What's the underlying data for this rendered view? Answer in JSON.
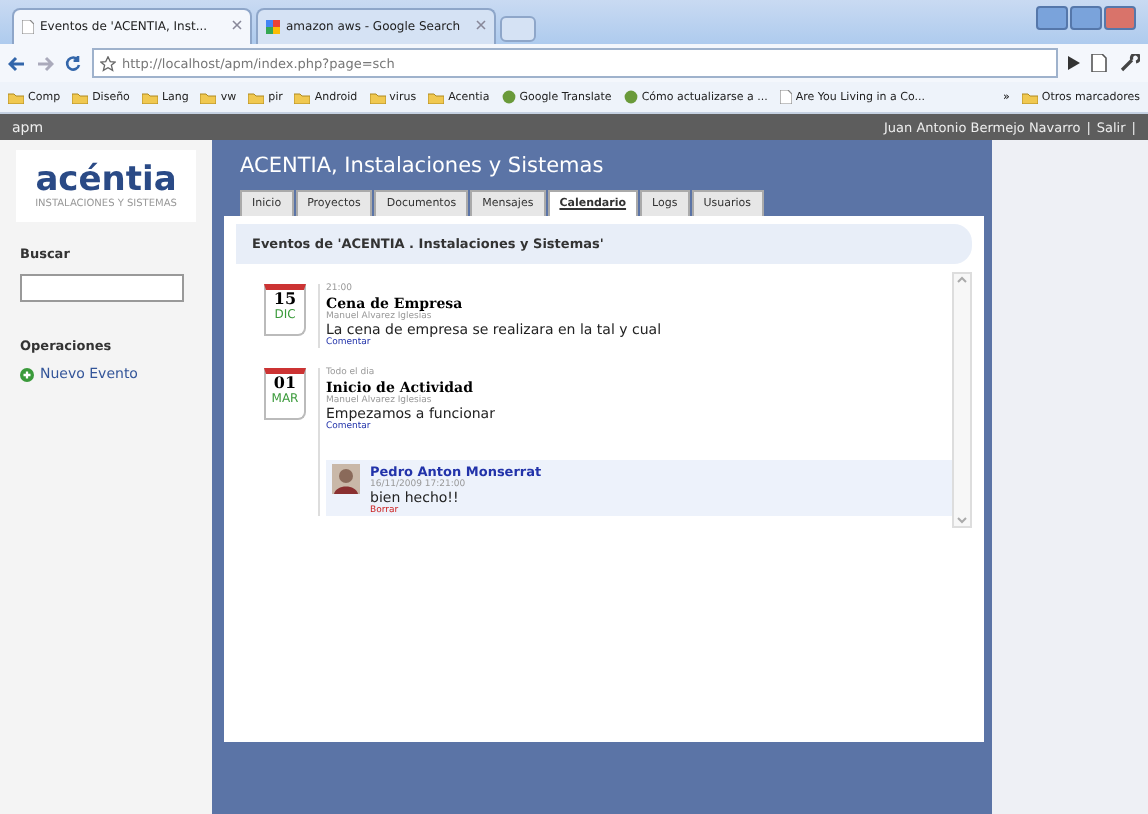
{
  "browser": {
    "tabs": [
      {
        "label": "Eventos de 'ACENTIA, Inst...",
        "selected": true
      },
      {
        "label": "amazon aws - Google Search",
        "selected": false
      }
    ],
    "url": "http://localhost/apm/index.php?page=sch",
    "bookmarks": [
      {
        "label": "Comp",
        "kind": "folder"
      },
      {
        "label": "Diseño",
        "kind": "folder"
      },
      {
        "label": "Lang",
        "kind": "folder"
      },
      {
        "label": "vw",
        "kind": "folder"
      },
      {
        "label": "pir",
        "kind": "folder"
      },
      {
        "label": "Android",
        "kind": "folder"
      },
      {
        "label": "virus",
        "kind": "folder"
      },
      {
        "label": "Acentia",
        "kind": "folder"
      },
      {
        "label": "Google Translate",
        "kind": "site"
      },
      {
        "label": "Cómo actualizarse a ...",
        "kind": "site"
      },
      {
        "label": "Are You Living in a Co...",
        "kind": "page"
      }
    ],
    "bookmarks_more": "»",
    "other_bookmarks": "Otros marcadores"
  },
  "app": {
    "name": "apm",
    "user": "Juan Antonio Bermejo Navarro",
    "separator_1": "|",
    "logout": "Salir",
    "separator_2": "|"
  },
  "sidebar": {
    "logo": "acéntia",
    "logo_tagline": "INSTALACIONES Y SISTEMAS",
    "search_label": "Buscar",
    "operations_label": "Operaciones",
    "new_event": "Nuevo Evento"
  },
  "main": {
    "title": "ACENTIA, Instalaciones y Sistemas",
    "tabs": [
      {
        "label": "Inicio",
        "selected": false
      },
      {
        "label": "Proyectos",
        "selected": false
      },
      {
        "label": "Documentos",
        "selected": false
      },
      {
        "label": "Mensajes",
        "selected": false
      },
      {
        "label": "Calendario",
        "selected": true
      },
      {
        "label": "Logs",
        "selected": false
      },
      {
        "label": "Usuarios",
        "selected": false
      }
    ],
    "heading": "Eventos de 'ACENTIA . Instalaciones y Sistemas'",
    "events": [
      {
        "day": "15",
        "month": "DIC",
        "time": "21:00",
        "title": "Cena de Empresa",
        "author": "Manuel Alvarez Iglesias",
        "description": "La cena de empresa se realizara en la tal y cual",
        "comment_link": "Comentar"
      },
      {
        "day": "01",
        "month": "MAR",
        "time": "Todo el dia",
        "title": "Inicio de Actividad",
        "author": "Manuel Alvarez Iglesias",
        "description": "Empezamos a funcionar",
        "comment_link": "Comentar",
        "comments": [
          {
            "author": "Pedro Anton Monserrat",
            "date": "16/11/2009 17:21:00",
            "text": "bien hecho!!",
            "delete": "Borrar"
          }
        ]
      }
    ]
  }
}
